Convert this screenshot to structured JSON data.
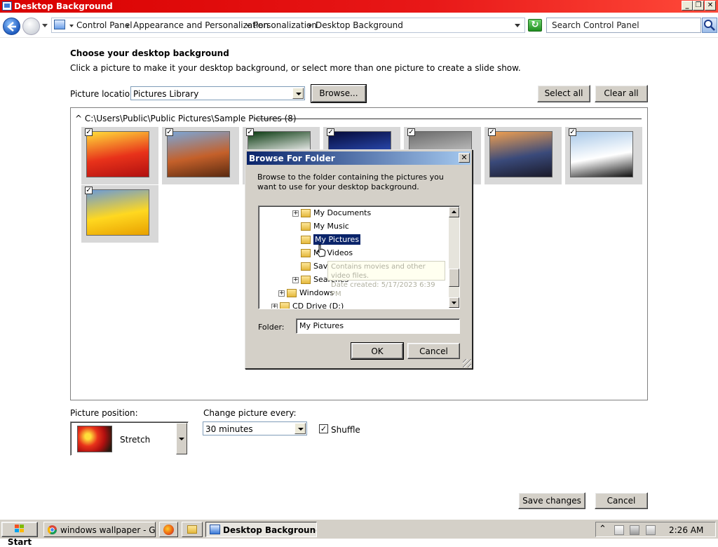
{
  "window": {
    "title": "Desktop Background",
    "controls": {
      "minimize": "_",
      "maximize": "❐",
      "close": "✕"
    }
  },
  "address_bar": {
    "breadcrumbs": [
      "Control Panel",
      "Appearance and Personalization",
      "Personalization",
      "Desktop Background"
    ],
    "search_placeholder": "Search Control Panel"
  },
  "main": {
    "heading": "Choose your desktop background",
    "description": "Click a picture to make it your desktop background, or select more than one picture to create a slide show.",
    "picture_location_label": "Picture location:",
    "picture_location_value": "Pictures Library",
    "browse_button": "Browse...",
    "select_all_button": "Select all",
    "clear_all_button": "Clear all",
    "gallery_header": "C:\\Users\\Public\\Public Pictures\\Sample Pictures (8)",
    "gallery_collapse_icon": "^",
    "thumbnails": [
      {
        "name": "flower-red",
        "checked": true,
        "colors": [
          "#ffde3a",
          "#e8321a",
          "#b01010"
        ]
      },
      {
        "name": "desert",
        "checked": true,
        "colors": [
          "#7aa6d8",
          "#c4602a",
          "#5a2a10"
        ]
      },
      {
        "name": "white-flower",
        "checked": true,
        "colors": [
          "#0a3a10",
          "#f0f0f0",
          "#2a6a2a"
        ]
      },
      {
        "name": "jellyfish",
        "checked": true,
        "colors": [
          "#050a3a",
          "#2a4ab0",
          "#e07a20"
        ]
      },
      {
        "name": "koala",
        "checked": true,
        "colors": [
          "#6a6a6a",
          "#bcbcbc",
          "#4a3a2a"
        ]
      },
      {
        "name": "lighthouse",
        "checked": true,
        "colors": [
          "#f0a050",
          "#3a4a7a",
          "#1a1a2a"
        ]
      },
      {
        "name": "penguins",
        "checked": true,
        "colors": [
          "#a8c8e8",
          "#ffffff",
          "#111111"
        ]
      },
      {
        "name": "tulips",
        "checked": true,
        "colors": [
          "#6a9ad8",
          "#ffd820",
          "#e8a000"
        ]
      }
    ],
    "picture_position_label": "Picture position:",
    "picture_position_value": "Stretch",
    "change_picture_label": "Change picture every:",
    "change_picture_value": "30 minutes",
    "shuffle_label": "Shuffle",
    "shuffle_checked": true,
    "save_button": "Save changes",
    "cancel_button": "Cancel"
  },
  "dialog": {
    "title": "Browse For Folder",
    "close": "✕",
    "text": "Browse to the folder containing the pictures you want to use for your desktop background.",
    "tree": [
      {
        "label": "My Documents",
        "expander": "+",
        "level": 2
      },
      {
        "label": "My Music",
        "expander": "",
        "level": 2
      },
      {
        "label": "My Pictures",
        "expander": "",
        "level": 2,
        "selected": true
      },
      {
        "label": "My Videos",
        "expander": "",
        "level": 2
      },
      {
        "label": "Saved Games",
        "expander": "",
        "level": 2
      },
      {
        "label": "Searches",
        "expander": "+",
        "level": 2
      },
      {
        "label": "Windows",
        "expander": "+",
        "level": 1
      },
      {
        "label": "CD Drive (D:)",
        "expander": "+",
        "level": 0
      }
    ],
    "tooltip_line1": "Contains movies and other video files.",
    "tooltip_line2": "Date created: 5/17/2023 6:39 PM",
    "folder_label": "Folder:",
    "folder_value": "My Pictures",
    "ok_button": "OK",
    "cancel_button": "Cancel"
  },
  "taskbar": {
    "start_label": "Start",
    "items": [
      {
        "label": "windows wallpaper - Goo...",
        "active": false
      },
      {
        "label": "",
        "active": false,
        "icon": "firefox"
      },
      {
        "label": "",
        "active": false,
        "icon": "folder"
      },
      {
        "label": "Desktop Background",
        "active": true
      }
    ],
    "tray_chevron": "⌃",
    "clock": "2:26 AM"
  }
}
